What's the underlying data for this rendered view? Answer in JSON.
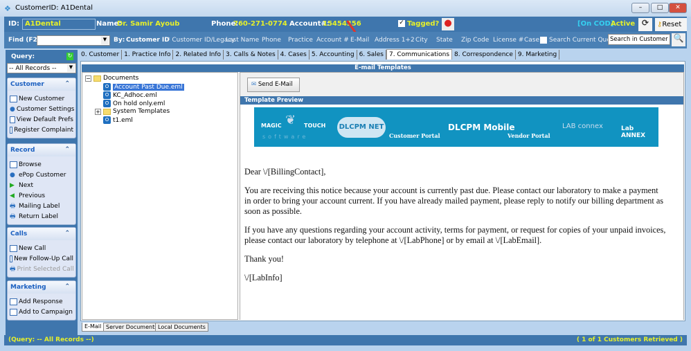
{
  "window": {
    "title": "CustomerID: A1Dental"
  },
  "header": {
    "id_label": "ID:",
    "id_value": "A1Dental",
    "name_label": "Name:",
    "name_value": "Dr. Samir Ayoub",
    "phone_label": "Phone:",
    "phone_value": "760-271-0774",
    "account_label": "Account#:",
    "account_value": "15454356",
    "tagged_label": "Tagged?",
    "tagged_checked": true,
    "status": "[On COD]",
    "status_active": "Active",
    "reset_label": "Reset"
  },
  "find": {
    "label": "Find (F2)",
    "by_label": "By:",
    "by_value": "Customer ID",
    "options": [
      "* Customer ID/Legacy",
      "Last Name",
      "Phone",
      "Practice",
      "Account #",
      "E-Mail",
      "Address 1+2",
      "City",
      "State",
      "Zip Code",
      "License #",
      "Case"
    ],
    "search_current_query": "Search Current Query",
    "search_placeholder": "Search in Customer"
  },
  "tabs": [
    "0. Customer",
    "1. Practice Info",
    "2. Related Info",
    "3. Calls & Notes",
    "4. Cases",
    "5. Accounting",
    "6. Sales",
    "7. Communications",
    "8. Correspondence",
    "9. Marketing"
  ],
  "active_tab": "7. Communications",
  "sidebar": {
    "query_label": "Query:",
    "query_value": "-- All Records --",
    "groups": [
      {
        "title": "Customer",
        "items": [
          "New Customer",
          "Customer Settings",
          "View Default Prefs",
          "Register Complaint"
        ]
      },
      {
        "title": "Record",
        "items": [
          "Browse",
          "ePop Customer",
          "Next",
          "Previous",
          "Mailing Label",
          "Return Label"
        ]
      },
      {
        "title": "Calls",
        "items": [
          "New Call",
          "New Follow-Up Call",
          "Print Selected Call"
        ]
      },
      {
        "title": "Marketing",
        "items": [
          "Add Response",
          "Add to Campaign"
        ]
      }
    ]
  },
  "panel": {
    "title": "E-mail Templates",
    "send_label": "Send E-Mail",
    "preview_title": "Template Preview"
  },
  "tree": {
    "root": "Documents",
    "items": [
      "Account Past Due.eml",
      "KC_Adhoc.eml",
      "On hold only.eml",
      "System Templates",
      "t1.eml"
    ],
    "selected": "Account Past Due.eml"
  },
  "banner": [
    "MAGIC",
    "TOUCH",
    "software",
    "DLCPM NET",
    "Customer Portal",
    "DLCPM Mobile",
    "Vendor Portal",
    "LAB connex",
    "Lab ANNEX"
  ],
  "email": {
    "greeting": "Dear \\/[BillingContact],",
    "p1": "You are receiving this notice because your account is currently past due. Please contact our laboratory to make a payment in order to bring your account current. If you have already mailed payment, please reply to notify our billing department as soon as possible.",
    "p2": "If you have any questions regarding your account activity, terms for payment, or request for copies of your unpaid invoices, please contact our laboratory by telephone at \\/[LabPhone] or by email at \\/[LabEmail].",
    "p3": "Thank you!",
    "p4": "\\/[LabInfo]"
  },
  "bottom_tabs": [
    "E-Mail",
    "Server Documents",
    "Local Documents"
  ],
  "statusbar": {
    "left": "(Query: -- All Records --)",
    "right": "( 1 of 1 Customers Retrieved )"
  },
  "colors": {
    "header": "#3f76ad",
    "highlight": "#e6f02a",
    "banner": "#1193c1"
  }
}
